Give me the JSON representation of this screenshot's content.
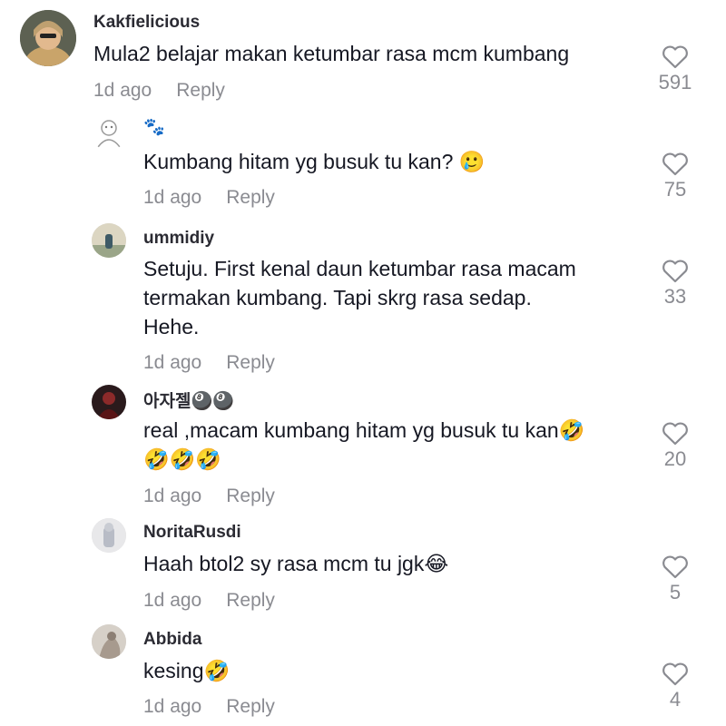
{
  "comments": [
    {
      "username": "Kakfielicious",
      "text": "Mula2 belajar makan ketumbar rasa mcm kumbang",
      "time": "1d ago",
      "reply": "Reply",
      "likes": "591"
    },
    {
      "username": "🐾",
      "text": "Kumbang hitam yg busuk tu kan? 🥲",
      "time": "1d ago",
      "reply": "Reply",
      "likes": "75"
    },
    {
      "username": "ummidiy",
      "text": "Setuju. First kenal daun ketumbar rasa macam\ntermakan kumbang. Tapi skrg rasa sedap.\nHehe.",
      "time": "1d ago",
      "reply": "Reply",
      "likes": "33"
    },
    {
      "username": "아자젤🎱🎱",
      "text": "real ,macam kumbang hitam yg busuk tu kan🤣\n🤣🤣🤣",
      "time": "1d ago",
      "reply": "Reply",
      "likes": "20"
    },
    {
      "username": "NoritaRusdi",
      "text": "Haah btol2 sy rasa mcm tu jgk😂",
      "time": "1d ago",
      "reply": "Reply",
      "likes": "5"
    },
    {
      "username": "Abbida",
      "text": "kesing🤣",
      "time": "1d ago",
      "reply": "Reply",
      "likes": "4"
    }
  ]
}
